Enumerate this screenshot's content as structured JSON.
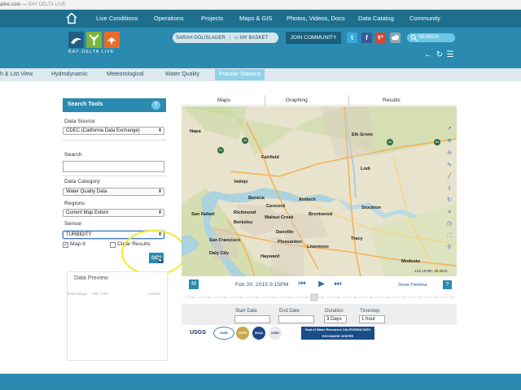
{
  "browser": {
    "host": "alive.com",
    "title": "BAY DELTA LIVE"
  },
  "topnav": {
    "items": [
      "Live Conditions",
      "Operations",
      "Projects",
      "Maps & GIS",
      "Photos, Videos, Docs",
      "Data Catalog",
      "Community"
    ]
  },
  "header": {
    "logo_text": "BAY·DELTA LIVE",
    "user": "SARAH DOLISLAGER",
    "basket": "MY BASKET",
    "join": "JOIN COMMUNITY",
    "search": "SEARCH",
    "social": [
      "t",
      "f",
      "g+",
      "flickr"
    ]
  },
  "tabs": {
    "items": [
      "h & List View",
      "Hydrodynamic",
      "Meteorological",
      "Water Quality",
      "Popular Stations"
    ],
    "active": "Popular Stations"
  },
  "search_tools": {
    "title": "Search Tools",
    "help": "?",
    "data_source_label": "Data Source",
    "data_source_value": "CDEC (California Data Exchange)",
    "search_label": "Search",
    "search_value": "",
    "category_label": "Data Category",
    "category_value": "Water Quality Data",
    "regions_label": "Regions",
    "regions_value": "Current Map Extent",
    "sensor_label": "Sensor",
    "sensor_value": "TURBIDITY",
    "map_it_label": "Map It",
    "map_it_checked": true,
    "clear_label": "Clear Results",
    "clear_checked": false,
    "go": "GO!"
  },
  "data_preview": {
    "title": "Data Preview",
    "columns": [
      "Data Range",
      "Title / Info",
      "Actions"
    ]
  },
  "map": {
    "tabs": [
      "Maps",
      "Graphing",
      "Results"
    ],
    "cities": [
      "Napa",
      "Vallejo",
      "Fairfield",
      "Elk Grove",
      "Antioch",
      "Concord",
      "Stockton",
      "Richmond",
      "Berkeley",
      "San Rafael",
      "San Francisco",
      "Daly City",
      "Hayward",
      "Modesto",
      "Lodi",
      "Walnut Creek",
      "Danville",
      "Brentwood",
      "Tracy",
      "Livermore",
      "Benicia",
      "Pleasanton"
    ],
    "markers": [
      "29",
      "65",
      "50"
    ],
    "tools": [
      "pointer",
      "zoom-in",
      "zoom-out",
      "pencil",
      "draw",
      "upload",
      "refresh",
      "layers",
      "clock",
      "fullscreen",
      "search"
    ],
    "scale": "-122.15780, 38.3815"
  },
  "timeline": {
    "m_button": "M",
    "date": "Feb 20, 2015 9:15PM",
    "show_timeline": "Show Timeline",
    "help": "?",
    "start_label": "Start Date",
    "end_label": "End Date",
    "duration_label": "Duration",
    "duration_value": "3 Days",
    "timestep_label": "Timestep",
    "timestep_value": "1 hour"
  },
  "partners": [
    "USGS",
    "DWR",
    "CDFW",
    "NOAA",
    "USBR",
    "Dept of Water Resources CALIFORNIA DATA EXCHANGE CENTER"
  ]
}
